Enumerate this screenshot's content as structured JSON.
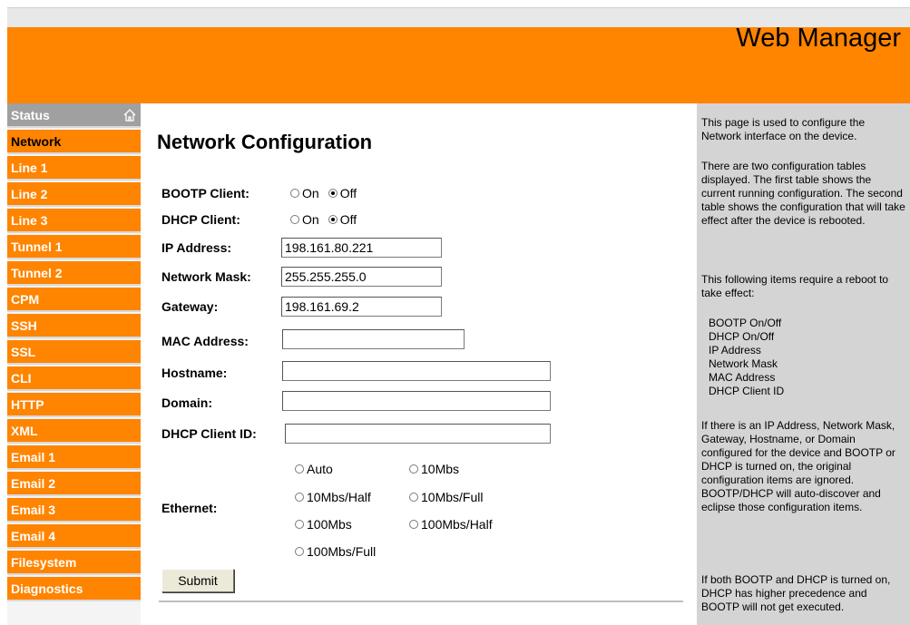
{
  "app": {
    "title": "Web Manager"
  },
  "sidebar": {
    "items": [
      {
        "label": "Status"
      },
      {
        "label": "Network"
      },
      {
        "label": "Line 1"
      },
      {
        "label": "Line 2"
      },
      {
        "label": "Line 3"
      },
      {
        "label": "Tunnel 1"
      },
      {
        "label": "Tunnel 2"
      },
      {
        "label": "CPM"
      },
      {
        "label": "SSH"
      },
      {
        "label": "SSL"
      },
      {
        "label": "CLI"
      },
      {
        "label": "HTTP"
      },
      {
        "label": "XML"
      },
      {
        "label": "Email 1"
      },
      {
        "label": "Email 2"
      },
      {
        "label": "Email 3"
      },
      {
        "label": "Email 4"
      },
      {
        "label": "Filesystem"
      },
      {
        "label": "Diagnostics"
      }
    ],
    "active": "Network"
  },
  "main": {
    "title": "Network Configuration",
    "bootp": {
      "label": "BOOTP Client:",
      "on": "On",
      "off": "Off",
      "selected": "Off"
    },
    "dhcp": {
      "label": "DHCP Client:",
      "on": "On",
      "off": "Off",
      "selected": "Off"
    },
    "ip": {
      "label": "IP Address:",
      "value": "198.161.80.221"
    },
    "mask": {
      "label": "Network Mask:",
      "value": "255.255.255.0"
    },
    "gateway": {
      "label": "Gateway:",
      "value": "198.161.69.2"
    },
    "mac": {
      "label": "MAC Address:",
      "value": ""
    },
    "hostname": {
      "label": "Hostname:",
      "value": ""
    },
    "domain": {
      "label": "Domain:",
      "value": ""
    },
    "client_id": {
      "label": "DHCP Client ID:",
      "value": ""
    },
    "ethernet": {
      "label": "Ethernet:",
      "options": [
        "Auto",
        "10Mbs",
        "10Mbs/Half",
        "10Mbs/Full",
        "100Mbs",
        "100Mbs/Half",
        "100Mbs/Full"
      ]
    },
    "submit_label": "Submit"
  },
  "help": {
    "p1": "This page is used to configure the Network interface on the device.",
    "p2": "There are two configuration tables displayed. The first table shows the current running configuration. The second table shows the configuration that will take effect after the device is rebooted.",
    "p3": "This following items require a reboot to take effect:",
    "list": [
      "BOOTP On/Off",
      "DHCP On/Off",
      "IP Address",
      "Network Mask",
      "MAC Address",
      "DHCP Client ID"
    ],
    "p4": "If there is an IP Address, Network Mask, Gateway, Hostname, or Domain configured for the device and BOOTP or DHCP is turned on, the original configuration items are ignored. BOOTP/DHCP will auto-discover and eclipse those configuration items.",
    "p5": "If both BOOTP and DHCP is turned on, DHCP has higher precedence and BOOTP will not get executed."
  }
}
